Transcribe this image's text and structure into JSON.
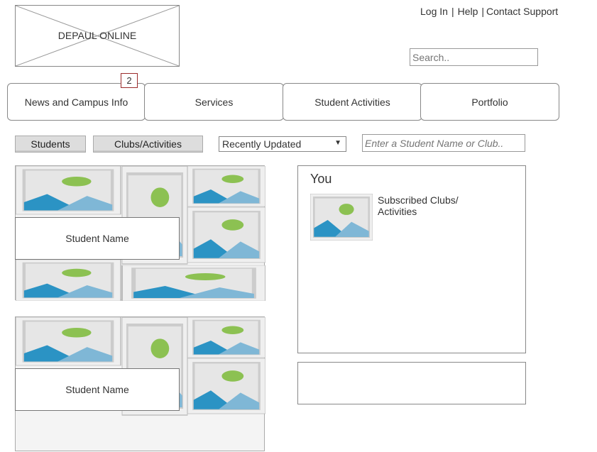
{
  "logo": {
    "text": "DEPAUL ONLINE"
  },
  "top_links": {
    "login": "Log In",
    "help": "Help",
    "contact": "Contact Support",
    "separator": "|"
  },
  "search": {
    "placeholder": "Search.."
  },
  "badge": {
    "count": "2"
  },
  "nav_tabs": [
    "News and Campus Info",
    "Services",
    "Student Activities",
    "Portfolio"
  ],
  "filters": {
    "students_label": "Students",
    "clubs_label": "Clubs/Activities",
    "sort_selected": "Recently Updated",
    "name_search_placeholder": "Enter a Student Name or Club.."
  },
  "cards": [
    {
      "name": "Student Name"
    },
    {
      "name": "Student Name"
    }
  ],
  "you_panel": {
    "title": "You",
    "subscribed_label": "Subscribed Clubs/ Activities"
  },
  "colors": {
    "badge_border": "#9b2c2c",
    "image_blue": "#2b93c4",
    "image_green": "#8cc152"
  },
  "icons": {
    "dropdown": "triangle-down-icon"
  }
}
